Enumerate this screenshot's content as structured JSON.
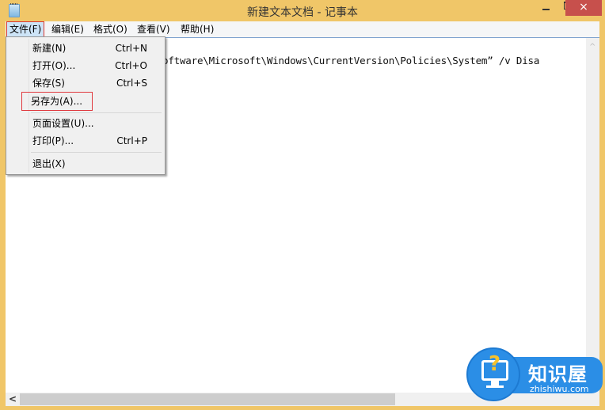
{
  "window": {
    "title": "新建文本文档 - 记事本",
    "minimize_label": "",
    "maximize_label": "",
    "close_label": "×"
  },
  "menubar": {
    "items": [
      {
        "label": "文件(F)",
        "active": true
      },
      {
        "label": "编辑(E)"
      },
      {
        "label": "格式(O)"
      },
      {
        "label": "查看(V)"
      },
      {
        "label": "帮助(H)"
      }
    ]
  },
  "file_menu": {
    "items": [
      {
        "label": "新建(N)",
        "shortcut": "Ctrl+N"
      },
      {
        "label": "打开(O)...",
        "shortcut": "Ctrl+O"
      },
      {
        "label": "保存(S)",
        "shortcut": "Ctrl+S"
      },
      {
        "label": "另存为(A)...",
        "shortcut": "",
        "highlighted": true
      },
      {
        "label": "页面设置(U)...",
        "shortcut": ""
      },
      {
        "label": "打印(P)...",
        "shortcut": "Ctrl+P"
      },
      {
        "label": "退出(X)",
        "shortcut": ""
      }
    ]
  },
  "editor": {
    "visible_text": "oftware\\Microsoft\\Windows\\CurrentVersion\\Policies\\System” /v Disa"
  },
  "scrollbars": {
    "up_arrow": "^",
    "left_arrow": "<"
  },
  "watermark": {
    "name": "知识屋",
    "url": "zhishiwu.com",
    "icon": "?"
  }
}
